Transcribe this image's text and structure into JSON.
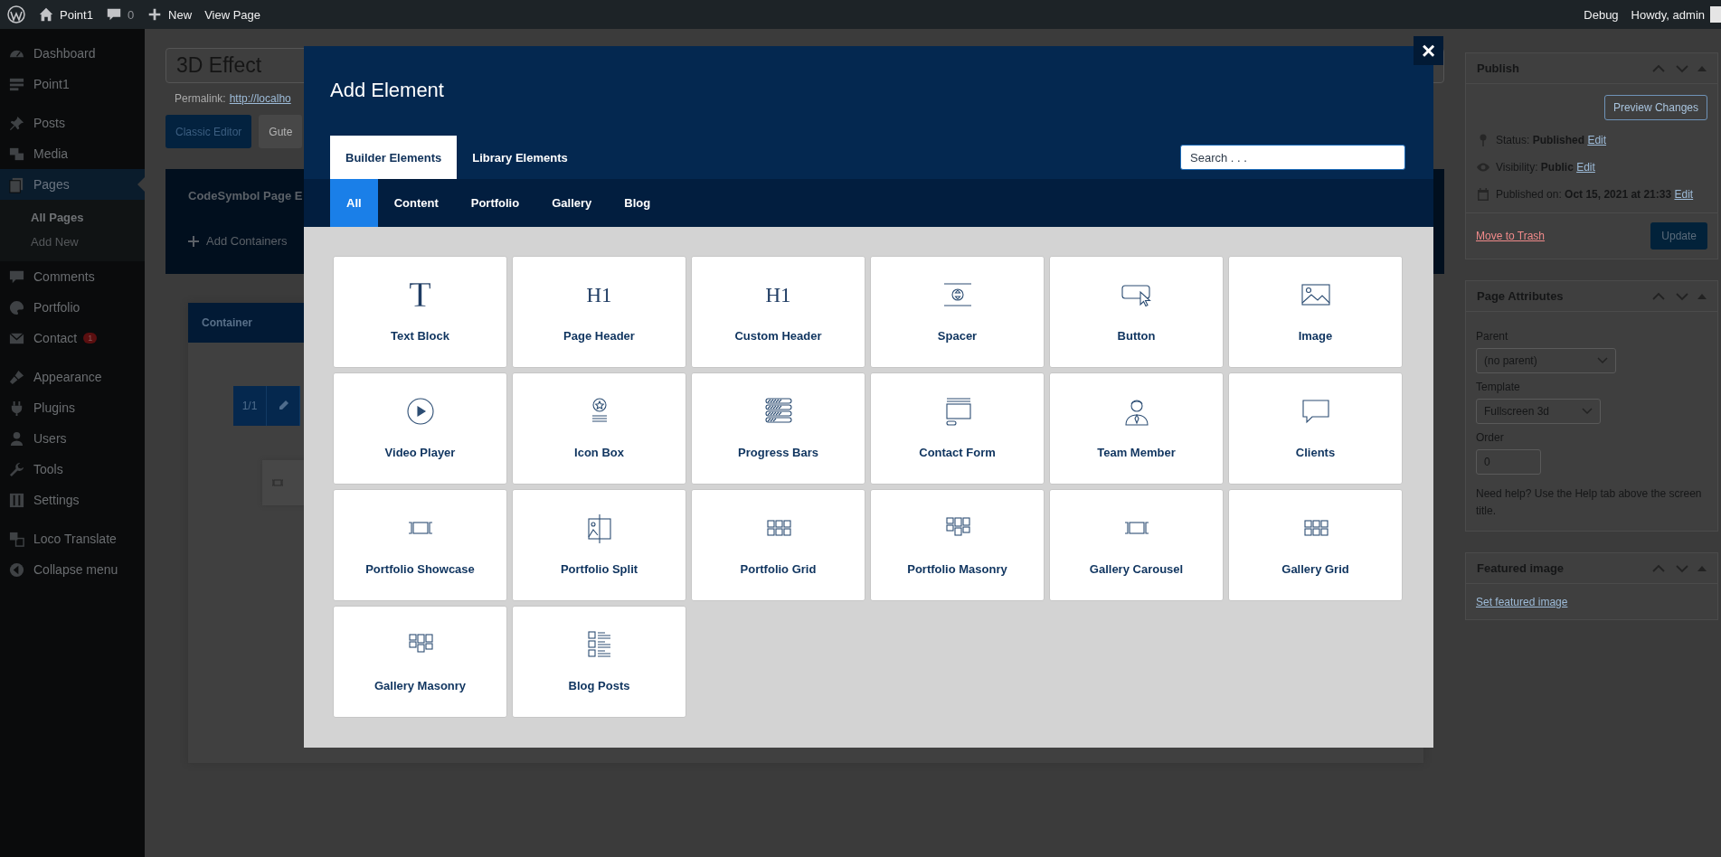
{
  "admin_bar": {
    "site": "Point1",
    "comments": "0",
    "new": "New",
    "view": "View Page",
    "debug": "Debug",
    "howdy": "Howdy, admin"
  },
  "sidebar": {
    "groups": [
      {
        "items": [
          {
            "label": "Dashboard",
            "kind": "dashboard",
            "selected": false
          },
          {
            "label": "Point1",
            "kind": "layout",
            "selected": false
          }
        ]
      },
      {
        "items": [
          {
            "label": "Posts",
            "kind": "pin",
            "selected": false
          },
          {
            "label": "Media",
            "kind": "media",
            "selected": false
          },
          {
            "label": "Pages",
            "kind": "pages",
            "selected": true,
            "children": [
              {
                "label": "All Pages",
                "selected": true
              },
              {
                "label": "Add New",
                "selected": false
              }
            ]
          },
          {
            "label": "Comments",
            "kind": "comment",
            "selected": false
          },
          {
            "label": "Portfolio",
            "kind": "palette",
            "selected": false
          },
          {
            "label": "Contact",
            "kind": "mail",
            "selected": false,
            "badge": "1"
          }
        ]
      },
      {
        "items": [
          {
            "label": "Appearance",
            "kind": "brush",
            "selected": false
          },
          {
            "label": "Plugins",
            "kind": "plug",
            "selected": false
          },
          {
            "label": "Users",
            "kind": "user",
            "selected": false
          },
          {
            "label": "Tools",
            "kind": "wrench",
            "selected": false
          },
          {
            "label": "Settings",
            "kind": "sliders",
            "selected": false
          }
        ]
      },
      {
        "items": [
          {
            "label": "Loco Translate",
            "kind": "translate",
            "selected": false
          },
          {
            "label": "Collapse menu",
            "kind": "collapse",
            "selected": false
          }
        ]
      }
    ]
  },
  "editor": {
    "title": "3D Effect",
    "permalink_label": "Permalink:",
    "permalink_url": "http://localho",
    "buttons": [
      {
        "label": "Classic Editor",
        "selected": true
      },
      {
        "label": "Gute",
        "selected": false
      }
    ],
    "builder_title": "CodeSymbol Page E",
    "add_containers": "Add Containers",
    "container_title": "Container",
    "column_label": "1/1"
  },
  "publish": {
    "title": "Publish",
    "preview": "Preview Changes",
    "lines": [
      {
        "kind": "pin",
        "text": "Status: **Published**",
        "link": "Edit"
      },
      {
        "kind": "eye",
        "text": "Visibility: **Public**",
        "link": "Edit"
      },
      {
        "kind": "calendar",
        "text": "Published on: **Oct 15, 2021 at 21:33**",
        "link": "Edit"
      }
    ],
    "trash": "Move to Trash",
    "update": "Update"
  },
  "page_attributes": {
    "title": "Page Attributes",
    "parent_label": "Parent",
    "parent_value": "(no parent)",
    "template_label": "Template",
    "template_value": "Fullscreen 3d",
    "order_label": "Order",
    "order_value": "0",
    "help": "Need help? Use the Help tab above the screen title."
  },
  "featured_image": {
    "title": "Featured image",
    "link": "Set featured image"
  },
  "modal": {
    "title": "Add Element",
    "close": "×",
    "tabs": [
      {
        "label": "Builder Elements",
        "selected": true
      },
      {
        "label": "Library Elements",
        "selected": false
      }
    ],
    "search": {
      "placeholder": "Search . . ."
    },
    "filters": [
      {
        "label": "All",
        "selected": true
      },
      {
        "label": "Content",
        "selected": false
      },
      {
        "label": "Portfolio",
        "selected": false
      },
      {
        "label": "Gallery",
        "selected": false
      },
      {
        "label": "Blog",
        "selected": false
      }
    ],
    "elements": [
      {
        "label": "Text Block",
        "kind": "glyph",
        "glyph": "T"
      },
      {
        "label": "Page Header",
        "kind": "glyph",
        "glyph": "H1"
      },
      {
        "label": "Custom Header",
        "kind": "glyph",
        "glyph": "H1"
      },
      {
        "label": "Spacer",
        "kind": "spacer"
      },
      {
        "label": "Button",
        "kind": "button"
      },
      {
        "label": "Image",
        "kind": "image"
      },
      {
        "label": "Video Player",
        "kind": "video"
      },
      {
        "label": "Icon Box",
        "kind": "iconbox"
      },
      {
        "label": "Progress Bars",
        "kind": "progress"
      },
      {
        "label": "Contact Form",
        "kind": "form"
      },
      {
        "label": "Team Member",
        "kind": "person"
      },
      {
        "label": "Clients",
        "kind": "chat"
      },
      {
        "label": "Portfolio Showcase",
        "kind": "carousel"
      },
      {
        "label": "Portfolio Split",
        "kind": "split"
      },
      {
        "label": "Portfolio Grid",
        "kind": "grid"
      },
      {
        "label": "Portfolio Masonry",
        "kind": "masonry"
      },
      {
        "label": "Gallery Carousel",
        "kind": "carousel"
      },
      {
        "label": "Gallery Grid",
        "kind": "grid"
      },
      {
        "label": "Gallery Masonry",
        "kind": "masonry"
      },
      {
        "label": "Blog Posts",
        "kind": "list"
      }
    ]
  }
}
